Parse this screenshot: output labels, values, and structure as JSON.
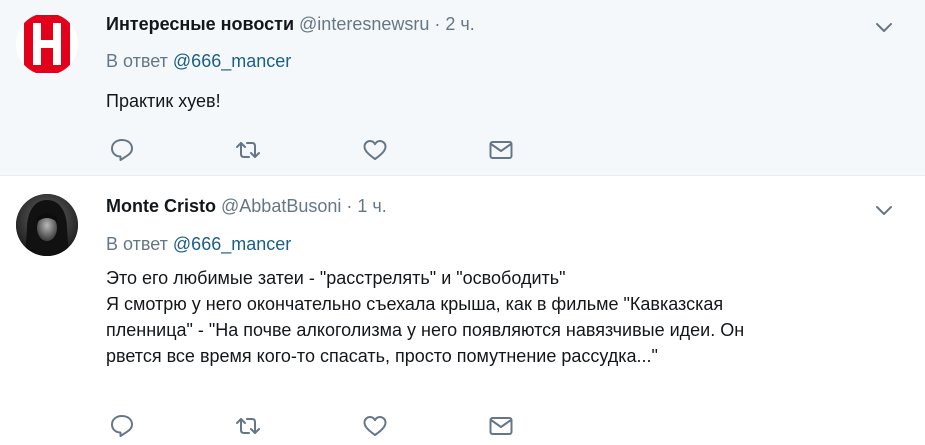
{
  "tweets": [
    {
      "name": "Интересные новости",
      "handle": "@interesnewsru",
      "separator": "·",
      "time": "2 ч.",
      "reply_prefix": "В ответ",
      "reply_to": "@666_mancer",
      "text": "Практик хуев!",
      "avatar": "red-h-logo"
    },
    {
      "name": "Monte Cristo",
      "handle": "@AbbatBusoni",
      "separator": "·",
      "time": "1 ч.",
      "reply_prefix": "В ответ",
      "reply_to": "@666_mancer",
      "text": "Это его любимые затеи - \"расстрелять\" и \"освободить\"\nЯ смотрю у него окончательно съехала крыша, как в фильме \"Кавказская\nпленница\" - \"На почве алкоголизма у него появляются  навязчивые идеи. Он\nрвется все время кого-то спасать, просто помутнение  рассудка...\"",
      "avatar": "hooded-figure-photo"
    }
  ],
  "icons": {
    "reply": "reply-icon",
    "retweet": "retweet-icon",
    "like": "heart-icon",
    "dm": "envelope-icon",
    "menu": "chevron-down-icon"
  },
  "colors": {
    "icon": "#657786",
    "mention": "#1b5e86",
    "logo_red": "#e2001a",
    "highlight_bg": "#f5f8fa"
  }
}
